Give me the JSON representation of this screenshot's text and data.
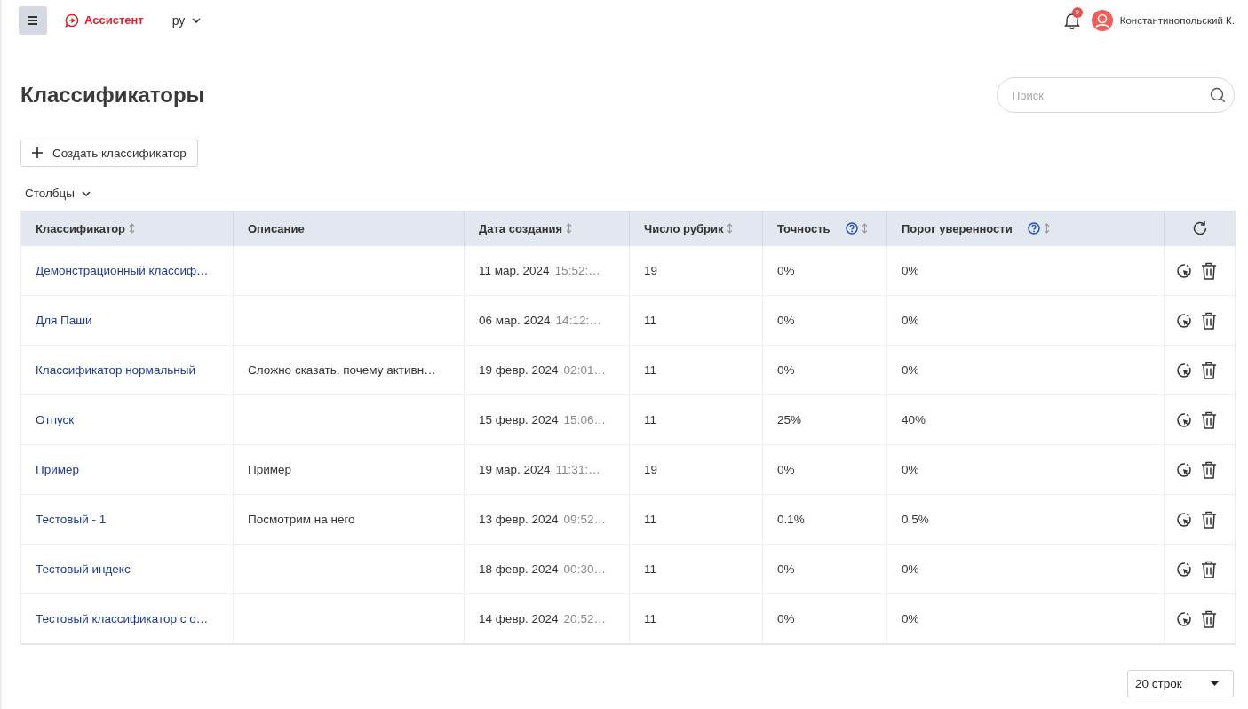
{
  "topbar": {
    "app_name": "Ассистент",
    "language": "ру",
    "notifications_count": "9",
    "user_name": "Константинопольский К."
  },
  "page": {
    "title": "Классификаторы",
    "search": {
      "placeholder": "Поиск"
    },
    "create_button": "Создать классификатор",
    "columns_menu": "Столбцы"
  },
  "table": {
    "columns": [
      {
        "label": "Классификатор",
        "sortable": true,
        "help": false
      },
      {
        "label": "Описание",
        "sortable": false,
        "help": false
      },
      {
        "label": "Дата создания",
        "sortable": true,
        "help": false
      },
      {
        "label": "Число рубрик",
        "sortable": true,
        "help": false
      },
      {
        "label": "Точность",
        "sortable": true,
        "help": true
      },
      {
        "label": "Порог уверенности",
        "sortable": true,
        "help": true
      }
    ],
    "rows": [
      {
        "name": "Демонстрационный классиф…",
        "description": "",
        "date": "11 мар. 2024",
        "time": "15:52:…",
        "rubrics": "19",
        "accuracy": "0%",
        "threshold": "0%"
      },
      {
        "name": "Для Паши",
        "description": "",
        "date": "06 мар. 2024",
        "time": "14:12:…",
        "rubrics": "11",
        "accuracy": "0%",
        "threshold": "0%"
      },
      {
        "name": "Классификатор нормальный",
        "description": "Сложно сказать, почему активн…",
        "date": "19 февр. 2024",
        "time": "02:01…",
        "rubrics": "11",
        "accuracy": "0%",
        "threshold": "0%"
      },
      {
        "name": "Отпуск",
        "description": "",
        "date": "15 февр. 2024",
        "time": "15:06…",
        "rubrics": "11",
        "accuracy": "25%",
        "threshold": "40%"
      },
      {
        "name": "Пример",
        "description": "Пример",
        "date": "19 мар. 2024",
        "time": "11:31:…",
        "rubrics": "19",
        "accuracy": "0%",
        "threshold": "0%"
      },
      {
        "name": "Тестовый - 1",
        "description": "Посмотрим на него",
        "date": "13 февр. 2024",
        "time": "09:52…",
        "rubrics": "11",
        "accuracy": "0.1%",
        "threshold": "0.5%"
      },
      {
        "name": "Тестовый индекс",
        "description": "",
        "date": "18 февр. 2024",
        "time": "00:30…",
        "rubrics": "11",
        "accuracy": "0%",
        "threshold": "0%"
      },
      {
        "name": "Тестовый классификатор с о…",
        "description": "",
        "date": "14 февр. 2024",
        "time": "20:52…",
        "rubrics": "11",
        "accuracy": "0%",
        "threshold": "0%"
      }
    ]
  },
  "pagination": {
    "rows_per_page": "20 строк"
  }
}
